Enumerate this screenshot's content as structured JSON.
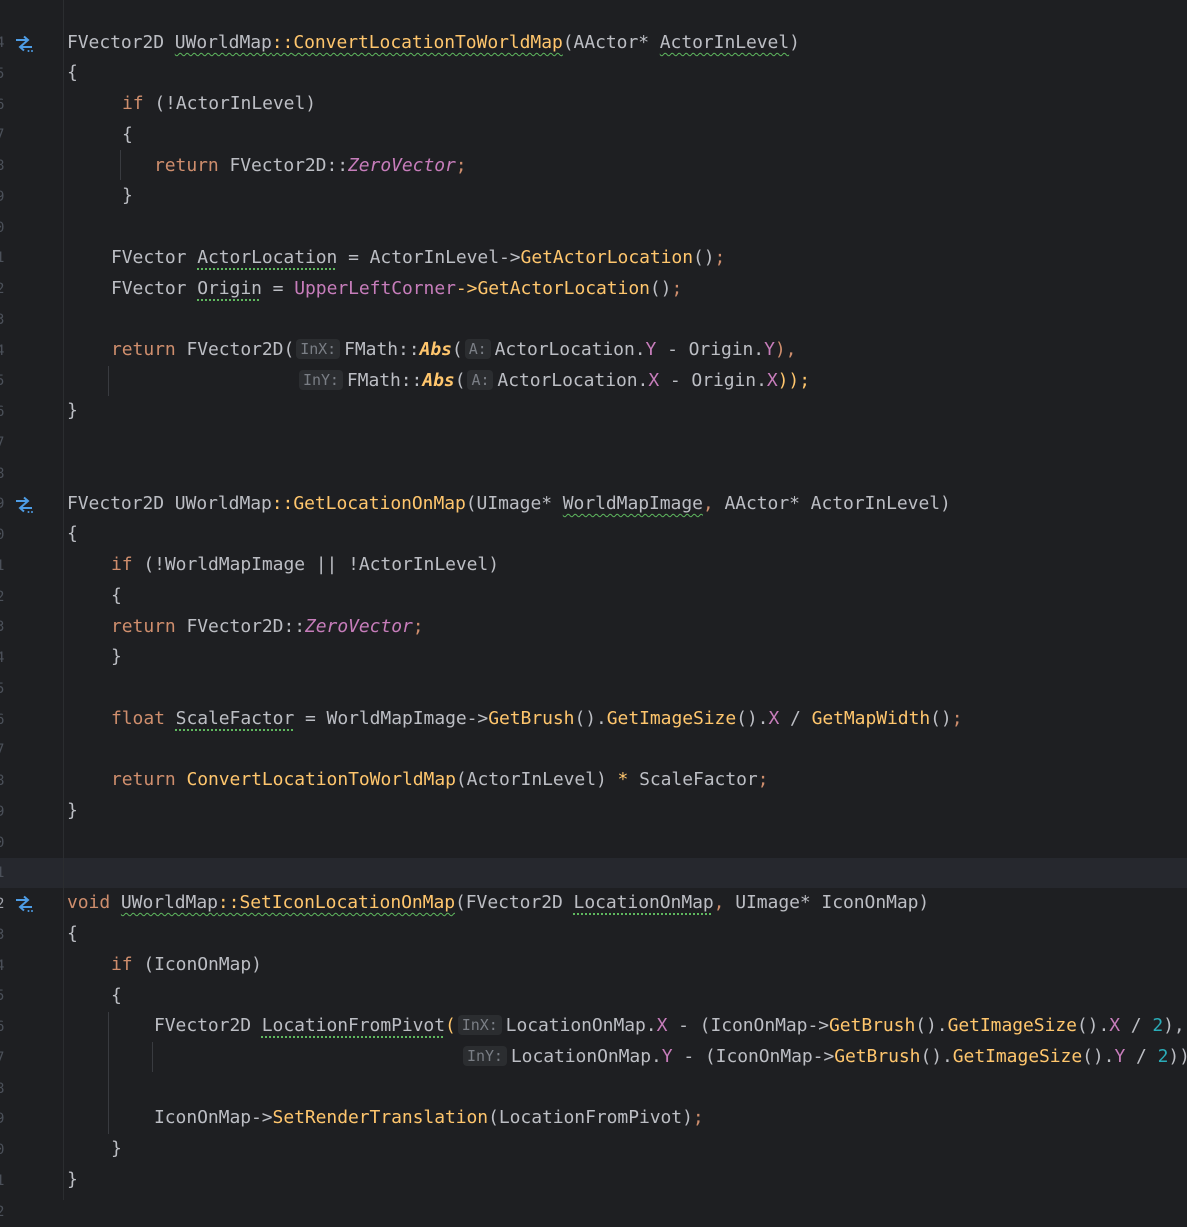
{
  "editor": {
    "line_numbers": [
      "4",
      "5",
      "6",
      "7",
      "8",
      "9",
      "0",
      "1",
      "2",
      "3",
      "4",
      "5",
      "6",
      "7",
      "8",
      "9",
      "0",
      "1",
      "2",
      "3",
      "4",
      "5",
      "6",
      "7",
      "8",
      "9",
      "0",
      "1",
      "2",
      "3",
      "4",
      "5",
      "6",
      "7",
      "8",
      "9",
      "0",
      "1",
      "2"
    ],
    "hints": {
      "inx": "InX:",
      "iny": "InY:",
      "a": "A:"
    },
    "code": {
      "l1": {
        "t0": "FVector2D ",
        "t1": "UWorldMap",
        "t2": "::",
        "t3": "ConvertLocationToWorldMap",
        "t4": "(AActor* ",
        "t5": "ActorInLevel",
        "t6": ")"
      },
      "l2": "{",
      "l3": {
        "kw": "if",
        "rest": " (!ActorInLevel)"
      },
      "l4": "{",
      "l5": {
        "kw": "return",
        "t1": " FVector2D::",
        "t2": "ZeroVector",
        "t3": ";"
      },
      "l6": "}",
      "l8": {
        "t0": "FVector ",
        "t1": "ActorLocation",
        "t2": " = ActorInLevel->",
        "t3": "GetActorLocation",
        "t4": "()",
        "t5": ";"
      },
      "l9": {
        "t0": "FVector ",
        "t1": "Origin",
        "t2": " = ",
        "t3": "UpperLeftCorner",
        "t4": "->",
        "t5": "GetActorLocation",
        "t6": "()",
        "t7": ";"
      },
      "l11": {
        "kw": "return",
        "t1": " FVector2D(",
        "t2": "FMath::",
        "t3": "Abs",
        "t4": "(",
        "t5": "ActorLocation.",
        "t6": "Y",
        "t7": " - Origin.",
        "t8": "Y",
        "t9": "),",
        "pad": "                  "
      },
      "l12": {
        "t2": "FMath::",
        "t3": "Abs",
        "t4": "(",
        "t5": "ActorLocation.",
        "t6": "X",
        "t7": " - Origin.",
        "t8": "X",
        "t9": "));"
      },
      "l13": "}",
      "l16": {
        "t0": "FVector2D ",
        "t1": "UWorldMap",
        "t2": "::",
        "t3": "GetLocationOnMap",
        "t4": "(UImage* ",
        "t5": "WorldMapImage",
        "t6": ", ",
        "t7": "AActor* ActorInLevel)"
      },
      "l17": "{",
      "l18": {
        "kw": "if",
        "rest": " (!WorldMapImage || !ActorInLevel)"
      },
      "l19": "{",
      "l20": {
        "kw": "return",
        "t1": " FVector2D::",
        "t2": "ZeroVector",
        "t3": ";"
      },
      "l21": "}",
      "l23": {
        "kw": "float",
        "t1": " ",
        "t2": "ScaleFactor",
        "t3": " = WorldMapImage->",
        "t4": "GetBrush",
        "t5": "().",
        "t6": "GetImageSize",
        "t7": "().",
        "t8": "X",
        "t9": " / ",
        "t10": "GetMapWidth",
        "t11": "()",
        "t12": ";"
      },
      "l25": {
        "kw": "return",
        "t1": " ",
        "t2": "ConvertLocationToWorldMap",
        "t3": "(ActorInLevel) ",
        "t4": "*",
        "t5": " ScaleFactor",
        "t6": ";"
      },
      "l26": "}",
      "l29": {
        "kw": "void",
        "t1": " ",
        "t2": "UWorldMap",
        "t3": "::",
        "t4": "SetIconLocationOnMap",
        "t5": "(FVector2D ",
        "t6": "LocationOnMap",
        "t7": ", ",
        "t8": "UImage* IconOnMap)"
      },
      "l30": "{",
      "l31": {
        "kw": "if",
        "rest": " (IconOnMap)"
      },
      "l32": "{",
      "l33": {
        "t0": "FVector2D ",
        "t1": "LocationFromPivot",
        "t2": "(",
        "t3": "LocationOnMap.",
        "t4": "X",
        "t5": " - (IconOnMap->",
        "t6": "GetBrush",
        "t7": "().",
        "t8": "GetImageSize",
        "t9": "().",
        "t10": "X",
        "t11": " / ",
        "t12": "2",
        "t13": "),",
        "pad": "                                           "
      },
      "l34": {
        "t3": "LocationOnMap.",
        "t4": "Y",
        "t5": " - (IconOnMap->",
        "t6": "GetBrush",
        "t7": "().",
        "t8": "GetImageSize",
        "t9": "().",
        "t10": "Y",
        "t11": " / ",
        "t12": "2",
        "t13": "))"
      },
      "l36": {
        "t0": "IconOnMap->",
        "t1": "SetRenderTranslation",
        "t2": "(LocationFromPivot)",
        "t3": ";"
      },
      "l37": "}",
      "l38": "}"
    },
    "icons": [
      "implementation-arrows-icon",
      "implementation-arrows-icon",
      "implementation-arrows-icon"
    ]
  }
}
